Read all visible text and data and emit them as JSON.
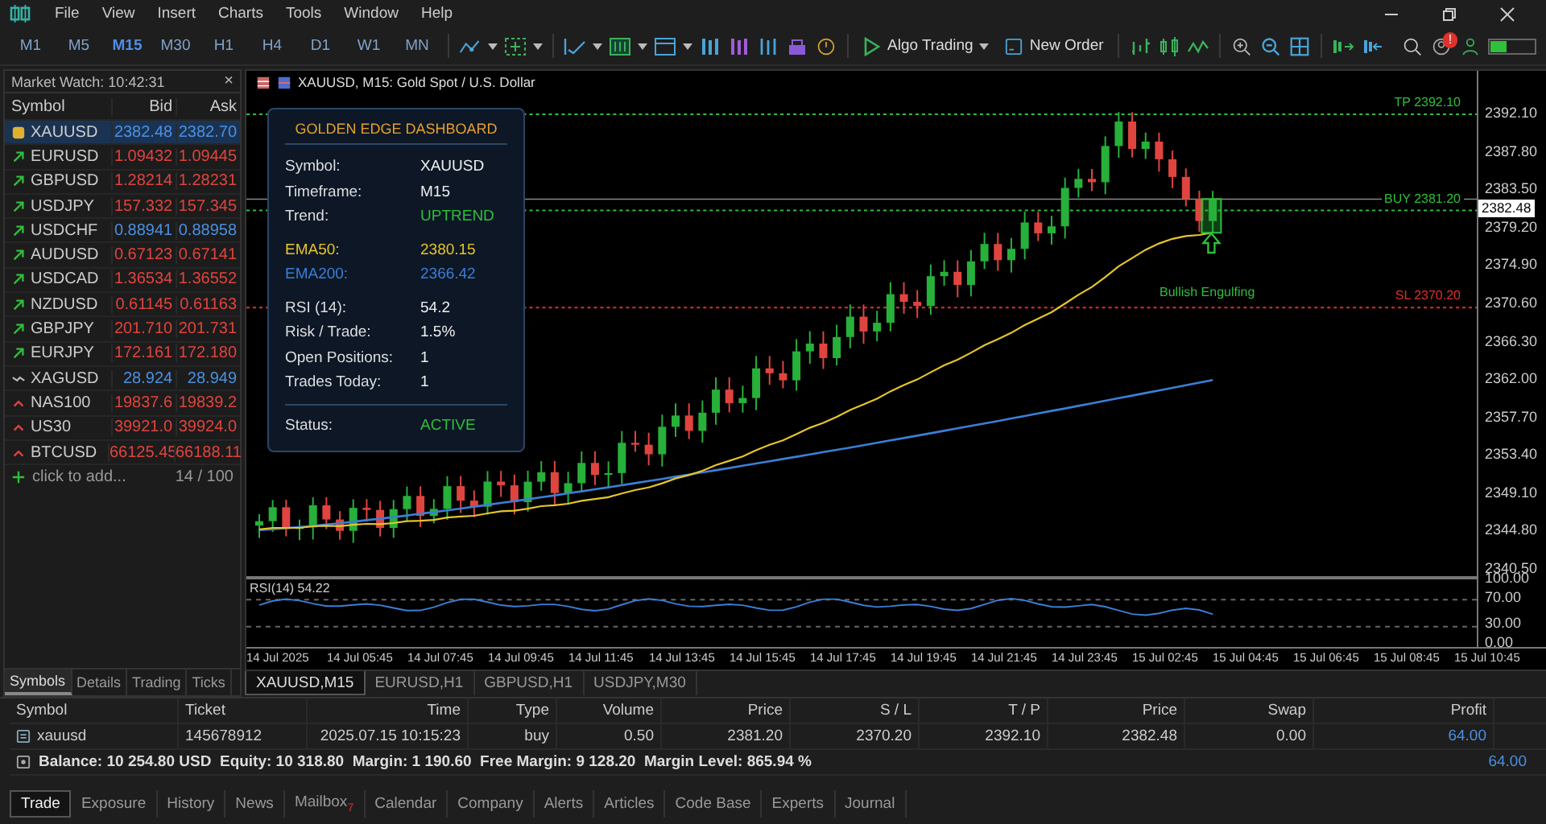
{
  "menu": [
    "File",
    "View",
    "Insert",
    "Charts",
    "Tools",
    "Window",
    "Help"
  ],
  "timeframes": [
    {
      "label": "M1",
      "selected": false
    },
    {
      "label": "M5",
      "selected": false
    },
    {
      "label": "M15",
      "selected": true
    },
    {
      "label": "M30",
      "selected": false
    },
    {
      "label": "H1",
      "selected": false
    },
    {
      "label": "H4",
      "selected": false
    },
    {
      "label": "D1",
      "selected": false
    },
    {
      "label": "W1",
      "selected": false
    },
    {
      "label": "MN",
      "selected": false
    }
  ],
  "toolbar": {
    "algo_trading": "Algo Trading",
    "new_order": "New Order",
    "alerts_badge": "!"
  },
  "market_watch": {
    "title": "Market Watch: 10:42:31",
    "close": "×",
    "columns": [
      "Symbol",
      "Bid",
      "Ask"
    ],
    "rows": [
      {
        "symbol": "XAUUSD",
        "bid": "2382.48",
        "ask": "2382.70",
        "kind": "gold",
        "color": "#4a90e2",
        "selected": true
      },
      {
        "symbol": "EURUSD",
        "bid": "1.09432",
        "ask": "1.09445",
        "kind": "rise",
        "color": "#e0443e",
        "selected": false
      },
      {
        "symbol": "GBPUSD",
        "bid": "1.28214",
        "ask": "1.28231",
        "kind": "rise",
        "color": "#e0443e",
        "selected": false
      },
      {
        "symbol": "USDJPY",
        "bid": "157.332",
        "ask": "157.345",
        "kind": "rise",
        "color": "#e0443e",
        "selected": false
      },
      {
        "symbol": "USDCHF",
        "bid": "0.88941",
        "ask": "0.88958",
        "kind": "rise",
        "color": "#4a90e2",
        "selected": false
      },
      {
        "symbol": "AUDUSD",
        "bid": "0.67123",
        "ask": "0.67141",
        "kind": "rise",
        "color": "#e0443e",
        "selected": false
      },
      {
        "symbol": "USDCAD",
        "bid": "1.36534",
        "ask": "1.36552",
        "kind": "rise",
        "color": "#e0443e",
        "selected": false
      },
      {
        "symbol": "NZDUSD",
        "bid": "0.61145",
        "ask": "0.61163",
        "kind": "rise",
        "color": "#e0443e",
        "selected": false
      },
      {
        "symbol": "GBPJPY",
        "bid": "201.710",
        "ask": "201.731",
        "kind": "rise",
        "color": "#e0443e",
        "selected": false
      },
      {
        "symbol": "EURJPY",
        "bid": "172.161",
        "ask": "172.180",
        "kind": "rise",
        "color": "#e0443e",
        "selected": false
      },
      {
        "symbol": "XAGUSD",
        "bid": "28.924",
        "ask": "28.949",
        "kind": "flat",
        "color": "#4a90e2",
        "selected": false
      },
      {
        "symbol": "NAS100",
        "bid": "19837.6",
        "ask": "19839.2",
        "kind": "fall",
        "color": "#e0443e",
        "selected": false
      },
      {
        "symbol": "US30",
        "bid": "39921.0",
        "ask": "39924.0",
        "kind": "fall",
        "color": "#e0443e",
        "selected": false
      },
      {
        "symbol": "BTCUSD",
        "bid": "66125.45",
        "ask": "66188.11",
        "kind": "fall",
        "color": "#e0443e",
        "selected": false
      }
    ],
    "add_label": "click to add...",
    "count": "14 / 100",
    "tabs": [
      {
        "label": "Symbols",
        "selected": true
      },
      {
        "label": "Details",
        "selected": false
      },
      {
        "label": "Trading",
        "selected": false
      },
      {
        "label": "Ticks",
        "selected": false
      }
    ]
  },
  "chart": {
    "title": "XAUUSD, M15:  Gold Spot / U.S. Dollar",
    "dashboard": {
      "title": "GOLDEN EDGE DASHBOARD",
      "sections": [
        {
          "divider": false,
          "rows": [
            {
              "label": "Symbol:",
              "value": "XAUUSD",
              "kind": "stat",
              "color": "#eeeeee"
            },
            {
              "label": "Timeframe:",
              "value": "M15",
              "kind": "stat",
              "color": "#eeeeee"
            },
            {
              "label": "Trend:",
              "value": "UPTREND",
              "kind": "stat",
              "color": "#2fbf3a"
            }
          ]
        },
        {
          "divider": false,
          "rows": [
            {
              "label": "EMA50:",
              "value": "2380.15",
              "kind": "indicator",
              "color": "#e6c52a"
            },
            {
              "label": "EMA200:",
              "value": "2366.42",
              "kind": "indicator",
              "color": "#3b7fd6"
            }
          ]
        },
        {
          "divider": false,
          "rows": [
            {
              "label": "RSI (14):",
              "value": "54.2",
              "kind": "stat",
              "color": "#eeeeee"
            },
            {
              "label": "Risk / Trade:",
              "value": "1.5%",
              "kind": "stat",
              "color": "#eeeeee"
            },
            {
              "label": "Open Positions:",
              "value": "1",
              "kind": "stat",
              "color": "#eeeeee"
            },
            {
              "label": "Trades Today:",
              "value": "1",
              "kind": "stat",
              "color": "#eeeeee"
            }
          ]
        },
        {
          "divider": true,
          "rows": [
            {
              "label": "Status:",
              "value": "ACTIVE",
              "kind": "stat",
              "color": "#2fbf3a"
            }
          ]
        }
      ]
    },
    "levels": [
      {
        "label": "TP 2392.10",
        "kind": "tp"
      },
      {
        "label": "BUY 2381.20",
        "kind": "buy"
      },
      {
        "label": "SL 2370.20",
        "kind": "sl"
      }
    ],
    "pattern_label": "Bullish Engulfing",
    "price_axis": [
      "2392.10",
      "2387.80",
      "2383.50",
      "2379.20",
      "2374.90",
      "2370.60",
      "2366.30",
      "2362.00",
      "2357.70",
      "2353.40",
      "2349.10",
      "2344.80",
      "2340.50"
    ],
    "current_price": "2382.48",
    "rsi": {
      "label": "RSI(14) 54.22",
      "axis": [
        "100.00",
        "70.00",
        "30.00",
        "0.00"
      ]
    },
    "time_axis": [
      "14 Jul 2025",
      "14 Jul 05:45",
      "14 Jul 07:45",
      "14 Jul 09:45",
      "14 Jul 11:45",
      "14 Jul 13:45",
      "14 Jul 15:45",
      "14 Jul 17:45",
      "14 Jul 19:45",
      "14 Jul 21:45",
      "14 Jul 23:45",
      "15 Jul 02:45",
      "15 Jul 04:45",
      "15 Jul 06:45",
      "15 Jul 08:45",
      "15 Jul 10:45"
    ],
    "tabs": [
      {
        "label": "XAUUSD,M15",
        "selected": true
      },
      {
        "label": "EURUSD,H1",
        "selected": false
      },
      {
        "label": "GBPUSD,H1",
        "selected": false
      },
      {
        "label": "USDJPY,M30",
        "selected": false
      }
    ]
  },
  "trade": {
    "columns": [
      "Symbol",
      "Ticket",
      "Time",
      "Type",
      "Volume",
      "Price",
      "S / L",
      "T / P",
      "Price",
      "Swap",
      "Profit"
    ],
    "rows": [
      {
        "cells": [
          "xauusd",
          "145678912",
          "2025.07.15 10:15:23",
          "buy",
          "0.50",
          "2381.20",
          "2370.20",
          "2392.10",
          "2382.48",
          "0.00",
          "64.00"
        ]
      }
    ],
    "summary": "Balance: 10 254.80 USD  Equity: 10 318.80  Margin: 1 190.60  Free Margin: 9 128.20  Margin Level: 865.94 %",
    "summary_profit": "64.00",
    "tabs": [
      {
        "label": "Trade",
        "selected": true
      },
      {
        "label": "Exposure",
        "selected": false
      },
      {
        "label": "History",
        "selected": false
      },
      {
        "label": "News",
        "selected": false
      },
      {
        "label": "Mailbox",
        "selected": false,
        "badge": "7"
      },
      {
        "label": "Calendar",
        "selected": false
      },
      {
        "label": "Company",
        "selected": false
      },
      {
        "label": "Alerts",
        "selected": false
      },
      {
        "label": "Articles",
        "selected": false
      },
      {
        "label": "Code Base",
        "selected": false
      },
      {
        "label": "Experts",
        "selected": false
      },
      {
        "label": "Journal",
        "selected": false
      }
    ]
  }
}
